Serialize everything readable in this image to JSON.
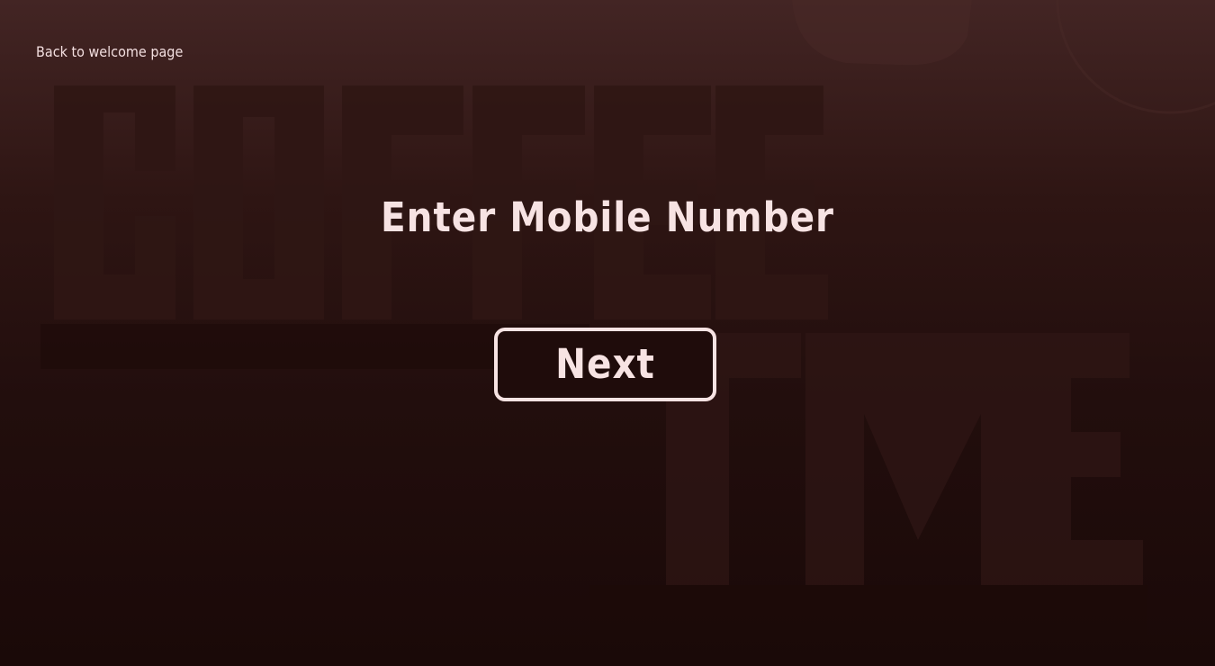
{
  "nav": {
    "back_label": "Back to welcome page"
  },
  "main": {
    "title": "Enter Mobile Number",
    "next_label": "Next"
  },
  "colors": {
    "text": "#f7e3e3",
    "background_top": "#432524",
    "background_bottom": "#1a0908",
    "button_fill": "#1f0c0b"
  }
}
